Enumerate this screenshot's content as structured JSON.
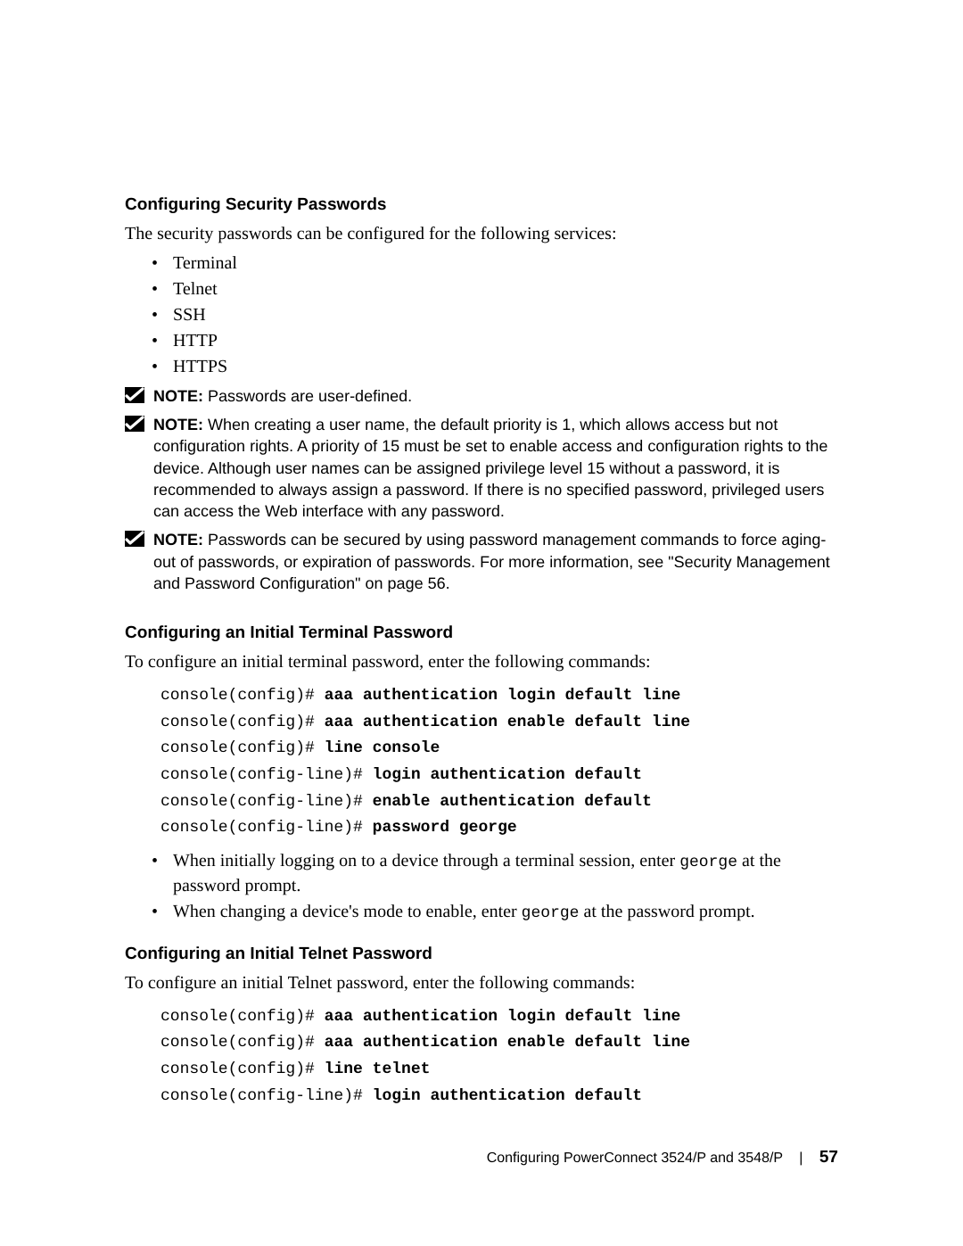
{
  "headings": {
    "h1": "Configuring Security Passwords",
    "h2": "Configuring an Initial Terminal Password",
    "h3": "Configuring an Initial Telnet Password"
  },
  "paras": {
    "p1": "The security passwords can be configured for the following services:",
    "p2": "To configure an initial terminal password, enter the following commands:",
    "p3": "To configure an initial Telnet password, enter the following commands:"
  },
  "services": {
    "s1": "Terminal",
    "s2": "Telnet",
    "s3": "SSH",
    "s4": "HTTP",
    "s5": "HTTPS"
  },
  "notes": {
    "label": "NOTE:",
    "n1": " Passwords are user-defined.",
    "n2": " When creating a user name, the default priority is 1, which allows access but not configuration rights. A priority of 15 must be set to enable access and configuration rights to the device. Although user names can be assigned privilege level 15 without a password, it is recommended to always assign a password. If there is no specified password, privileged users can access the Web interface with any password.",
    "n3": " Passwords can be secured by using password management commands to force aging-out of passwords, or expiration of passwords. For more information, see \"Security Management and Password Configuration\" on page 56."
  },
  "code": {
    "prompt_cfg": "console(config)# ",
    "prompt_line": "console(config-line)# ",
    "c1b": "aaa authentication login default line",
    "c2b": "aaa authentication enable default line",
    "c3b": "line console",
    "c4b": "login authentication default",
    "c5b": "enable authentication default",
    "c6b": "password george",
    "t3b": "line telnet"
  },
  "bullets2": {
    "b1a": "When initially logging on to a device through a terminal session, enter ",
    "b1mono": "george",
    "b1b": " at the password prompt.",
    "b2a": "When changing a device's mode to enable, enter ",
    "b2mono": "george",
    "b2b": " at the password prompt."
  },
  "footer": {
    "title": "Configuring PowerConnect 3524/P and 3548/P",
    "page": "57"
  }
}
